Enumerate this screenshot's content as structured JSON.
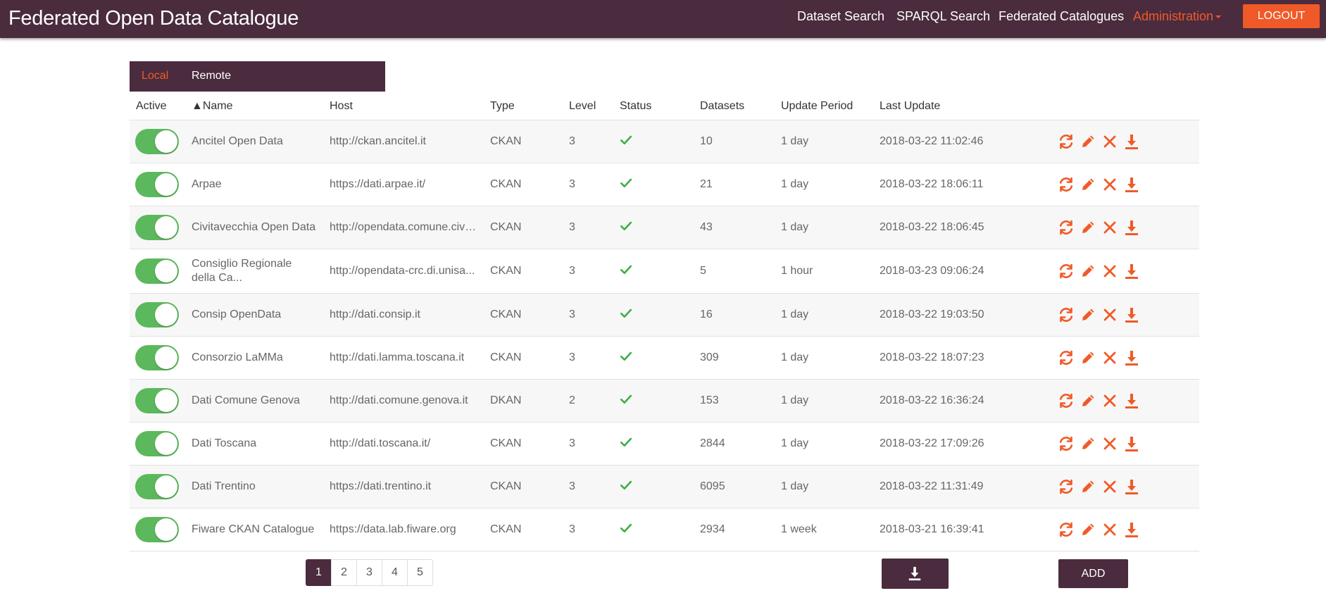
{
  "app": {
    "title": "Federated Open Data Catalogue"
  },
  "nav": {
    "items": [
      {
        "label": "Dataset Search"
      },
      {
        "label": "SPARQL Search"
      },
      {
        "label": "Federated Catalogues"
      },
      {
        "label": "Administration"
      }
    ],
    "logout_label": "LOGOUT"
  },
  "tabs": [
    {
      "label": "Local"
    },
    {
      "label": "Remote"
    }
  ],
  "table": {
    "headers": {
      "active": "Active",
      "name": "▲Name",
      "host": "Host",
      "type": "Type",
      "level": "Level",
      "status": "Status",
      "datasets": "Datasets",
      "update_period": "Update Period",
      "last_update": "Last Update"
    },
    "rows": [
      {
        "name": "Ancitel Open Data",
        "host": "http://ckan.ancitel.it",
        "type": "CKAN",
        "level": "3",
        "datasets": "10",
        "period": "1 day",
        "last_update": "2018-03-22 11:02:46"
      },
      {
        "name": "Arpae",
        "host": "https://dati.arpae.it/",
        "type": "CKAN",
        "level": "3",
        "datasets": "21",
        "period": "1 day",
        "last_update": "2018-03-22 18:06:11"
      },
      {
        "name": "Civitavecchia Open Data",
        "host": "http://opendata.comune.civit...",
        "type": "CKAN",
        "level": "3",
        "datasets": "43",
        "period": "1 day",
        "last_update": "2018-03-22 18:06:45"
      },
      {
        "name": "Consiglio Regionale della Ca...",
        "host": "http://opendata-crc.di.unisa...",
        "type": "CKAN",
        "level": "3",
        "datasets": "5",
        "period": "1 hour",
        "last_update": "2018-03-23 09:06:24"
      },
      {
        "name": "Consip OpenData",
        "host": "http://dati.consip.it",
        "type": "CKAN",
        "level": "3",
        "datasets": "16",
        "period": "1 day",
        "last_update": "2018-03-22 19:03:50"
      },
      {
        "name": "Consorzio LaMMa",
        "host": "http://dati.lamma.toscana.it",
        "type": "CKAN",
        "level": "3",
        "datasets": "309",
        "period": "1 day",
        "last_update": "2018-03-22 18:07:23"
      },
      {
        "name": "Dati Comune Genova",
        "host": "http://dati.comune.genova.it",
        "type": "DKAN",
        "level": "2",
        "datasets": "153",
        "period": "1 day",
        "last_update": "2018-03-22 16:36:24"
      },
      {
        "name": "Dati Toscana",
        "host": "http://dati.toscana.it/",
        "type": "CKAN",
        "level": "3",
        "datasets": "2844",
        "period": "1 day",
        "last_update": "2018-03-22 17:09:26"
      },
      {
        "name": "Dati Trentino",
        "host": "https://dati.trentino.it",
        "type": "CKAN",
        "level": "3",
        "datasets": "6095",
        "period": "1 day",
        "last_update": "2018-03-22 11:31:49"
      },
      {
        "name": "Fiware CKAN Catalogue",
        "host": "https://data.lab.fiware.org",
        "type": "CKAN",
        "level": "3",
        "datasets": "2934",
        "period": "1 week",
        "last_update": "2018-03-21 16:39:41"
      }
    ]
  },
  "pagination": {
    "pages": [
      "1",
      "2",
      "3",
      "4",
      "5"
    ],
    "current": "1"
  },
  "add_label": "ADD",
  "colors": {
    "brand": "#4a2c3e",
    "accent": "#f05a28",
    "toggle_on": "#5cb85c",
    "status_ok": "#3cb043"
  }
}
